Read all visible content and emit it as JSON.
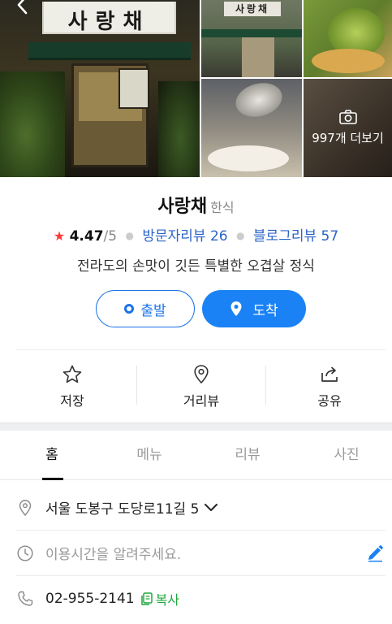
{
  "gallery": {
    "sign_text": "사랑채",
    "more_count_label": "997개 더보기"
  },
  "place": {
    "name": "사랑채",
    "category": "한식",
    "rating": "4.47",
    "rating_max": "/5",
    "visitor_review_label": "방문자리뷰 26",
    "blog_review_label": "블로그리뷰 57",
    "description": "전라도의 손맛이 깃든 특별한 오겹살 정식"
  },
  "buttons": {
    "depart": "출발",
    "arrive": "도착"
  },
  "actions": {
    "save": "저장",
    "street_view": "거리뷰",
    "share": "공유"
  },
  "tabs": [
    {
      "label": "홈"
    },
    {
      "label": "메뉴"
    },
    {
      "label": "리뷰"
    },
    {
      "label": "사진"
    }
  ],
  "details": {
    "address": "서울 도봉구 도당로11길 5",
    "hours_placeholder": "이용시간을 알려주세요.",
    "phone": "02-955-2141",
    "copy_label": "복사"
  },
  "colors": {
    "accent_blue": "#1a82f5",
    "link_blue": "#2b64c8",
    "star_red": "#ff3b3b",
    "copy_green": "#22a73f"
  }
}
